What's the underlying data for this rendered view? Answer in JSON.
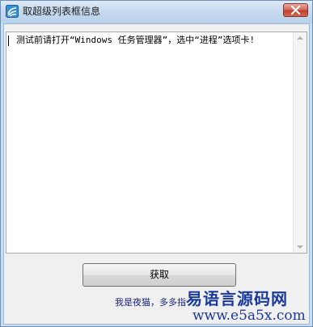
{
  "window": {
    "title": "取超级列表框信息",
    "close_label": "×"
  },
  "textbox": {
    "content": "测试前请打开“Windows 任务管理器”，选中“进程”选项卡!"
  },
  "actions": {
    "get_label": "获取"
  },
  "footer": {
    "author_text": "我是夜猫，多多指"
  },
  "watermark": {
    "title": "易语言源码网",
    "url": "www.e5a5x.com"
  },
  "icons": {
    "app": "app-icon",
    "close": "close-icon",
    "scroll_up": "arrow-up-icon",
    "scroll_down": "arrow-down-icon"
  },
  "colors": {
    "titlebar": "#c5d9ef",
    "close_button": "#c4402c",
    "watermark": "#1a3a9c",
    "author_text": "#1a237e"
  }
}
